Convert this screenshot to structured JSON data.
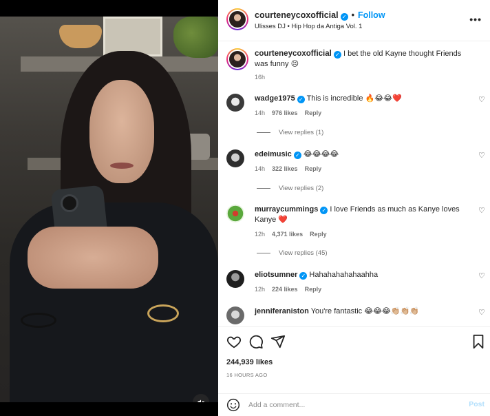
{
  "post": {
    "username": "courteneycoxofficial",
    "follow_label": "Follow",
    "separator": "•",
    "audio": "Ulisses DJ • Hip Hop da Antiga Vol. 1",
    "more_label": "•••"
  },
  "caption": {
    "username": "courteneycoxofficial",
    "text": "I bet the old Kayne thought Friends was funny 😣",
    "time": "16h"
  },
  "comments": [
    {
      "username": "wadge1975",
      "text": "This is incredible 🔥😂😂❤️",
      "time": "14h",
      "likes": "976 likes",
      "reply": "Reply",
      "view_replies": "View replies (1)"
    },
    {
      "username": "edeimusic",
      "text": "😂😂😂😂",
      "time": "14h",
      "likes": "322 likes",
      "reply": "Reply",
      "view_replies": "View replies (2)"
    },
    {
      "username": "murraycummings",
      "text": "I love Friends as much as Kanye loves Kanye ❤️",
      "time": "12h",
      "likes": "4,371 likes",
      "reply": "Reply",
      "view_replies": "View replies (45)"
    },
    {
      "username": "eliotsumner",
      "text": "Hahahahahahaahha",
      "time": "12h",
      "likes": "224 likes",
      "reply": "Reply",
      "view_replies": ""
    },
    {
      "username": "jenniferaniston",
      "text": "You're fantastic 😂😂😂👏🏼👏🏼👏🏼",
      "time": "",
      "likes": "",
      "reply": "",
      "view_replies": ""
    }
  ],
  "footer": {
    "likes": "244,939 likes",
    "posted": "16 HOURS AGO",
    "comment_placeholder": "Add a comment...",
    "post_label": "Post"
  },
  "icons": {
    "heart": "heart-icon",
    "comment": "comment-icon",
    "share": "share-icon",
    "save": "bookmark-icon",
    "emoji": "emoji-icon",
    "mute": "mute-icon"
  },
  "colors": {
    "accent": "#0095f6",
    "post_disabled": "#b2dffc",
    "muted_text": "#737373"
  }
}
